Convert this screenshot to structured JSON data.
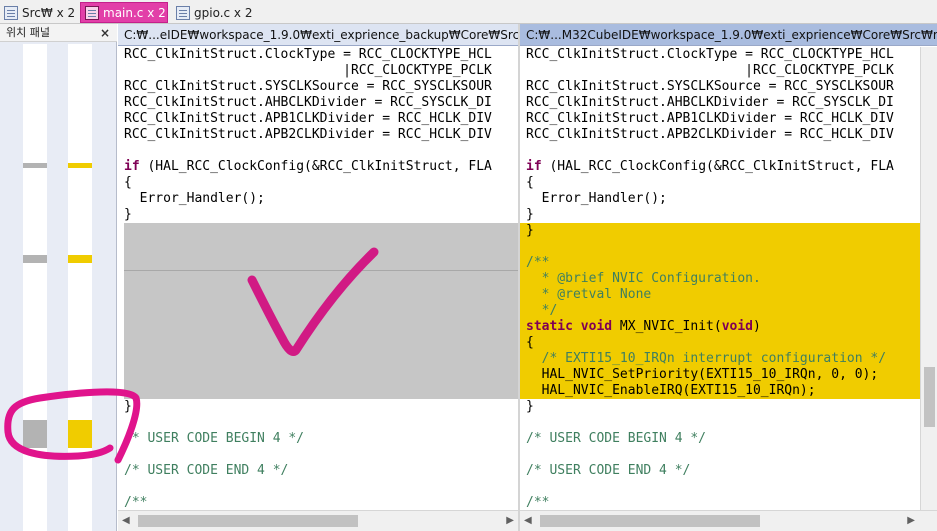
{
  "tabs": [
    {
      "label": "Src₩ x 2"
    },
    {
      "label": "main.c x 2"
    },
    {
      "label": "gpio.c x 2"
    }
  ],
  "location_pane": {
    "title": "위치 패널",
    "close": "×"
  },
  "left_path": "C:₩...eIDE₩workspace_1.9.0₩exti_exprience_backup₩Core₩Src₩main.c",
  "right_path": "C:₩...M32CubeIDE₩workspace_1.9.0₩exti_exprience₩Core₩Src₩main.c",
  "left_code": [
    "RCC_ClkInitStruct.ClockType = RCC_CLOCKTYPE_HCL",
    "                            |RCC_CLOCKTYPE_PCLK",
    "RCC_ClkInitStruct.SYSCLKSource = RCC_SYSCLKSOUR",
    "RCC_ClkInitStruct.AHBCLKDivider = RCC_SYSCLK_DI",
    "RCC_ClkInitStruct.APB1CLKDivider = RCC_HCLK_DIV",
    "RCC_ClkInitStruct.APB2CLKDivider = RCC_HCLK_DIV",
    "",
    "if (HAL_RCC_ClockConfig(&RCC_ClkInitStruct, FLA",
    "{",
    "  Error_Handler();",
    "}",
    "",
    "",
    "",
    "",
    "",
    "",
    "",
    "",
    "",
    "",
    "",
    "}",
    "",
    "/* USER CODE BEGIN 4 */",
    "",
    "/* USER CODE END 4 */",
    "",
    "/**"
  ],
  "right_code": [
    "RCC_ClkInitStruct.ClockType = RCC_CLOCKTYPE_HCL",
    "                            |RCC_CLOCKTYPE_PCLK",
    "RCC_ClkInitStruct.SYSCLKSource = RCC_SYSCLKSOUR",
    "RCC_ClkInitStruct.AHBCLKDivider = RCC_SYSCLK_DI",
    "RCC_ClkInitStruct.APB1CLKDivider = RCC_HCLK_DIV",
    "RCC_ClkInitStruct.APB2CLKDivider = RCC_HCLK_DIV",
    "",
    "if (HAL_RCC_ClockConfig(&RCC_ClkInitStruct, FLA",
    "{",
    "  Error_Handler();",
    "}",
    "}",
    "",
    "/**",
    "  * @brief NVIC Configuration.",
    "  * @retval None",
    "  */",
    "static void MX_NVIC_Init(void)",
    "{",
    "  /* EXTI15_10_IRQn interrupt configuration */",
    "  HAL_NVIC_SetPriority(EXTI15_10_IRQn, 0, 0);",
    "  HAL_NVIC_EnableIRQ(EXTI15_10_IRQn);",
    "}",
    "",
    "/* USER CODE BEGIN 4 */",
    "",
    "/* USER CODE END 4 */",
    "",
    "/**"
  ],
  "colors": {
    "added_highlight": "#f0cc00",
    "removed_highlight": "#c6c6c6",
    "annotation": "#e0148c",
    "active_tab": "#e23fa8"
  },
  "icons": [
    "file-icon",
    "close-icon",
    "scroll-left-icon",
    "scroll-right-icon",
    "checkmark-annotation",
    "circle-annotation"
  ]
}
